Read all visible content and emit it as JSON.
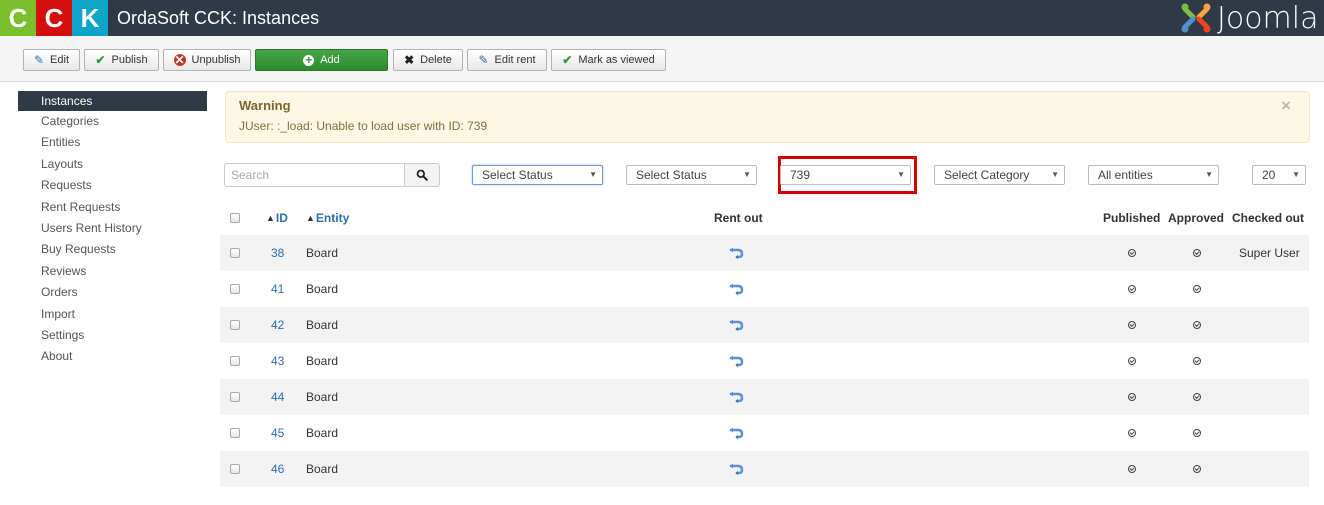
{
  "header": {
    "logo_letters": [
      "C",
      "C",
      "K"
    ],
    "title": "OrdaSoft CCK: Instances",
    "brand_text": "Joomla"
  },
  "toolbar": {
    "buttons": [
      {
        "label": "Edit",
        "icon": "edit-icon"
      },
      {
        "label": "Publish",
        "icon": "check-icon"
      },
      {
        "label": "Unpublish",
        "icon": "unpublish-icon"
      },
      {
        "label": "Add",
        "icon": "plus-circle-icon"
      },
      {
        "label": "Delete",
        "icon": "x-icon"
      },
      {
        "label": "Edit rent",
        "icon": "edit-icon"
      },
      {
        "label": "Mark as viewed",
        "icon": "check-icon"
      }
    ]
  },
  "sidebar": {
    "active": "Instances",
    "items": [
      {
        "label": "Instances"
      },
      {
        "label": "Categories"
      },
      {
        "label": "Entities"
      },
      {
        "label": "Layouts"
      },
      {
        "label": "Requests"
      },
      {
        "label": "Rent Requests"
      },
      {
        "label": "Users Rent History"
      },
      {
        "label": "Buy Requests"
      },
      {
        "label": "Reviews"
      },
      {
        "label": "Orders"
      },
      {
        "label": "Import"
      },
      {
        "label": "Settings"
      },
      {
        "label": "About"
      }
    ]
  },
  "alert": {
    "title": "Warning",
    "message": "JUser: :_load: Unable to load user with ID: 739",
    "close_symbol": "×",
    "colors": {
      "background": "#fcf8e3",
      "text": "#8a6d3b"
    }
  },
  "filters": {
    "search": {
      "placeholder": "Search",
      "value": ""
    },
    "selects": [
      {
        "value": "Select Status"
      },
      {
        "value": "Select Status"
      },
      {
        "value": "739"
      },
      {
        "value": "Select Category"
      },
      {
        "value": "All entities"
      },
      {
        "value": "20"
      }
    ]
  },
  "table": {
    "columns": {
      "id": "ID",
      "entity": "Entity",
      "rent_out": "Rent out",
      "published": "Published",
      "approved": "Approved",
      "checked_out": "Checked out"
    },
    "rows": [
      {
        "id": "38",
        "entity": "Board",
        "checked_out": "Super User"
      },
      {
        "id": "41",
        "entity": "Board",
        "checked_out": ""
      },
      {
        "id": "42",
        "entity": "Board",
        "checked_out": ""
      },
      {
        "id": "43",
        "entity": "Board",
        "checked_out": ""
      },
      {
        "id": "44",
        "entity": "Board",
        "checked_out": ""
      },
      {
        "id": "45",
        "entity": "Board",
        "checked_out": ""
      },
      {
        "id": "46",
        "entity": "Board",
        "checked_out": ""
      }
    ]
  }
}
